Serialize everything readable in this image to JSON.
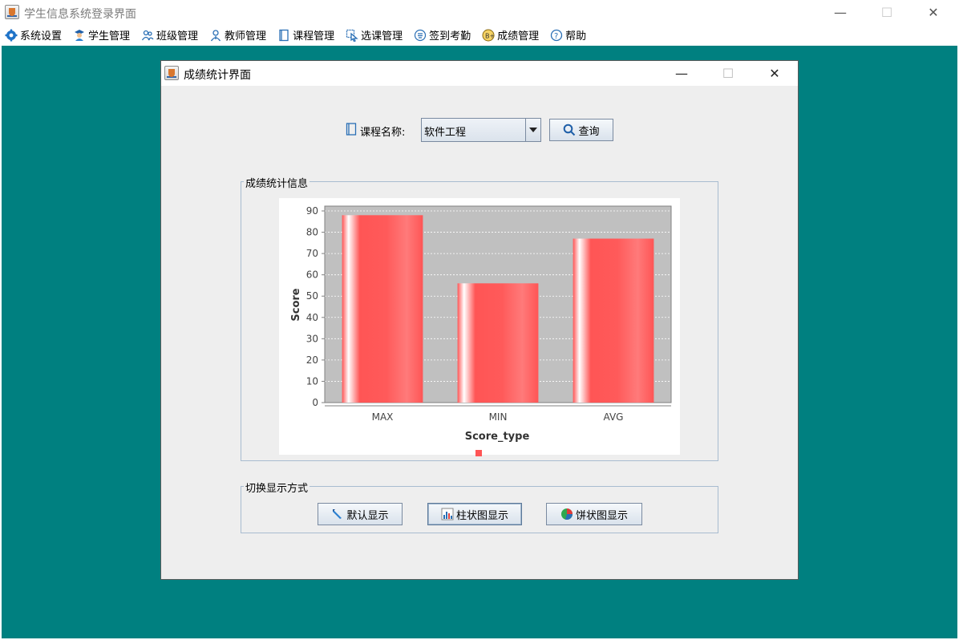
{
  "window": {
    "title": "学生信息系统登录界面",
    "controls": {
      "minimize": "—",
      "maximize": "☐",
      "close": "✕"
    }
  },
  "menu": {
    "items": [
      {
        "label": "系统设置",
        "icon": "gear-icon"
      },
      {
        "label": "学生管理",
        "icon": "student-icon"
      },
      {
        "label": "班级管理",
        "icon": "class-icon"
      },
      {
        "label": "教师管理",
        "icon": "teacher-icon"
      },
      {
        "label": "课程管理",
        "icon": "book-icon"
      },
      {
        "label": "选课管理",
        "icon": "cursor-icon"
      },
      {
        "label": "签到考勤",
        "icon": "attendance-icon"
      },
      {
        "label": "成绩管理",
        "icon": "grade-icon"
      },
      {
        "label": "帮助",
        "icon": "help-icon"
      }
    ]
  },
  "frame": {
    "title": "成绩统计界面",
    "controls": {
      "minimize": "—",
      "maximize": "☐",
      "close": "✕"
    },
    "course_label": "课程名称:",
    "course_value": "软件工程",
    "query_label": "查询",
    "stats_group_label": "成绩统计信息",
    "switch_group_label": "切换显示方式",
    "buttons": {
      "default_label": "默认显示",
      "bar_label": "柱状图显示",
      "pie_label": "饼状图显示"
    }
  },
  "colors": {
    "desktop": "#008080",
    "bar": "#ff5555",
    "plot_bg": "#c0c0c0"
  },
  "chart_data": {
    "type": "bar",
    "categories": [
      "MAX",
      "MIN",
      "AVG"
    ],
    "series": [
      {
        "values": [
          88,
          56,
          77
        ]
      }
    ],
    "xlabel": "Score_type",
    "ylabel": "Score",
    "ylim": [
      0,
      90
    ],
    "yticks": [
      0,
      10,
      20,
      30,
      40,
      50,
      60,
      70,
      80,
      90
    ],
    "grid": true
  }
}
